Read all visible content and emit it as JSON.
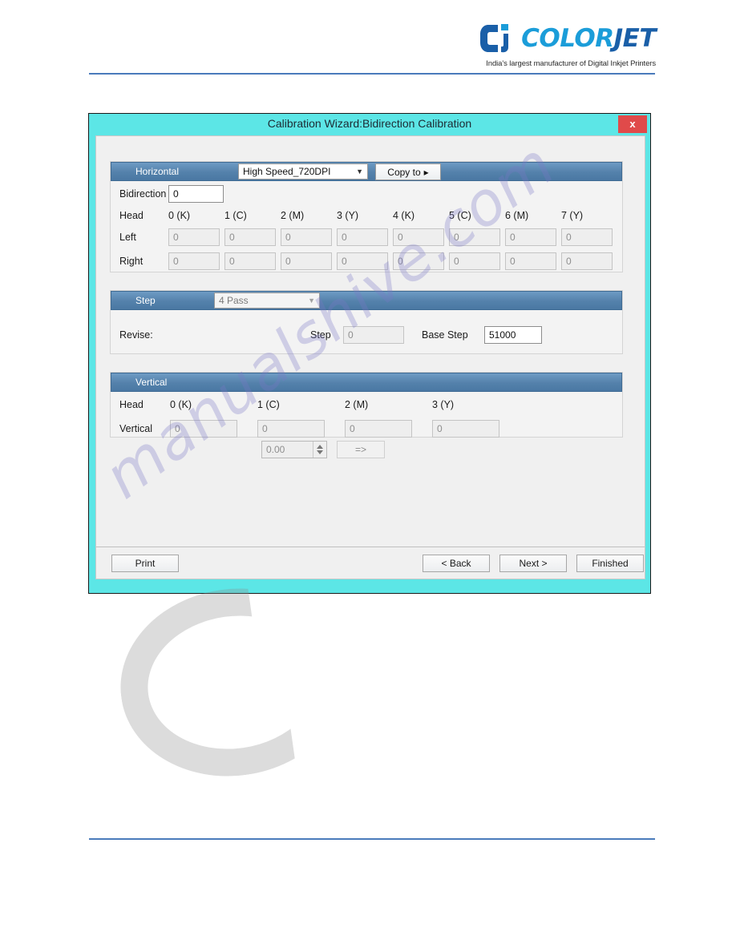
{
  "brand": {
    "logo_mark": "colorjet-logo-icon",
    "name_part1": "COLOR",
    "name_part2": "JET",
    "tagline": "India's largest manufacturer of Digital Inkjet Printers",
    "accent_blue": "#1b9dd9",
    "accent_navy": "#1a5fa8",
    "rule_color": "#4a7bbb"
  },
  "watermark": {
    "text": "manualshive.com"
  },
  "dialog": {
    "title": "Calibration Wizard:Bidirection Calibration",
    "close_label": "x",
    "titlebar_color": "#5ce6e6",
    "close_color": "#e04a4a",
    "horizontal": {
      "header_label": "Horizontal",
      "mode_value": "High Speed_720DPI",
      "copy_to_label": "Copy to",
      "copy_to_arrow": "▸",
      "bidirection_label": "Bidirection",
      "bidirection_value": "0",
      "head_label": "Head",
      "heads": [
        "0  (K)",
        "1  (C)",
        "2  (M)",
        "3  (Y)",
        "4  (K)",
        "5  (C)",
        "6  (M)",
        "7  (Y)"
      ],
      "left_label": "Left",
      "left_values": [
        "0",
        "0",
        "0",
        "0",
        "0",
        "0",
        "0",
        "0"
      ],
      "right_label": "Right",
      "right_values": [
        "0",
        "0",
        "0",
        "0",
        "0",
        "0",
        "0",
        "0"
      ]
    },
    "step": {
      "header_label": "Step",
      "pass_value": "4 Pass",
      "revise_label": "Revise:",
      "revise_value": "0.00",
      "apply_label": "=>",
      "step_label": "Step",
      "step_value": "0",
      "base_step_label": "Base Step",
      "base_step_value": "51000"
    },
    "vertical": {
      "header_label": "Vertical",
      "head_label": "Head",
      "heads": [
        "0  (K)",
        "1  (C)",
        "2  (M)",
        "3  (Y)"
      ],
      "vertical_label": "Vertical",
      "vertical_values": [
        "0",
        "0",
        "0",
        "0"
      ]
    },
    "footer": {
      "print_label": "Print",
      "back_label": "< Back",
      "next_label": "Next >",
      "finished_label": "Finished"
    }
  }
}
